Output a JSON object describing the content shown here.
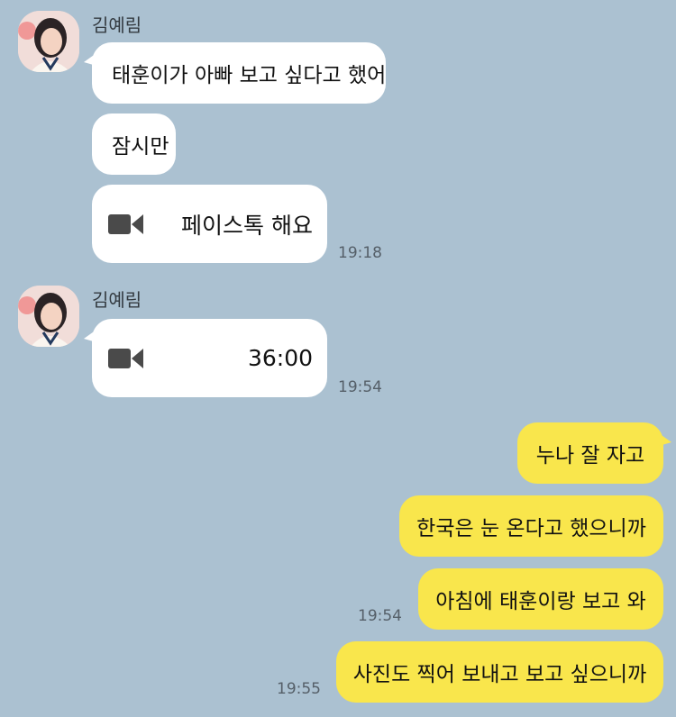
{
  "messages": [
    {
      "sender": "김예림",
      "text": "태훈이가 아빠 보고 싶다고 했어"
    },
    {
      "text": "잠시만"
    },
    {
      "type": "call",
      "icon": "video-camera-icon",
      "text": "페이스톡 해요",
      "time": "19:18"
    },
    {
      "sender": "김예림",
      "type": "call",
      "icon": "video-camera-icon",
      "text": "36:00",
      "time": "19:54"
    },
    {
      "text": "누나 잘 자고"
    },
    {
      "text": "한국은 눈 온다고 했으니까"
    },
    {
      "text": "아침에 태훈이랑 보고 와",
      "time": "19:54"
    },
    {
      "text": "사진도 찍어 보내고 보고 싶으니까",
      "time": "19:55"
    }
  ],
  "colors": {
    "background": "#abc1d1",
    "incoming_bubble": "#ffffff",
    "outgoing_bubble": "#f9e64c"
  }
}
